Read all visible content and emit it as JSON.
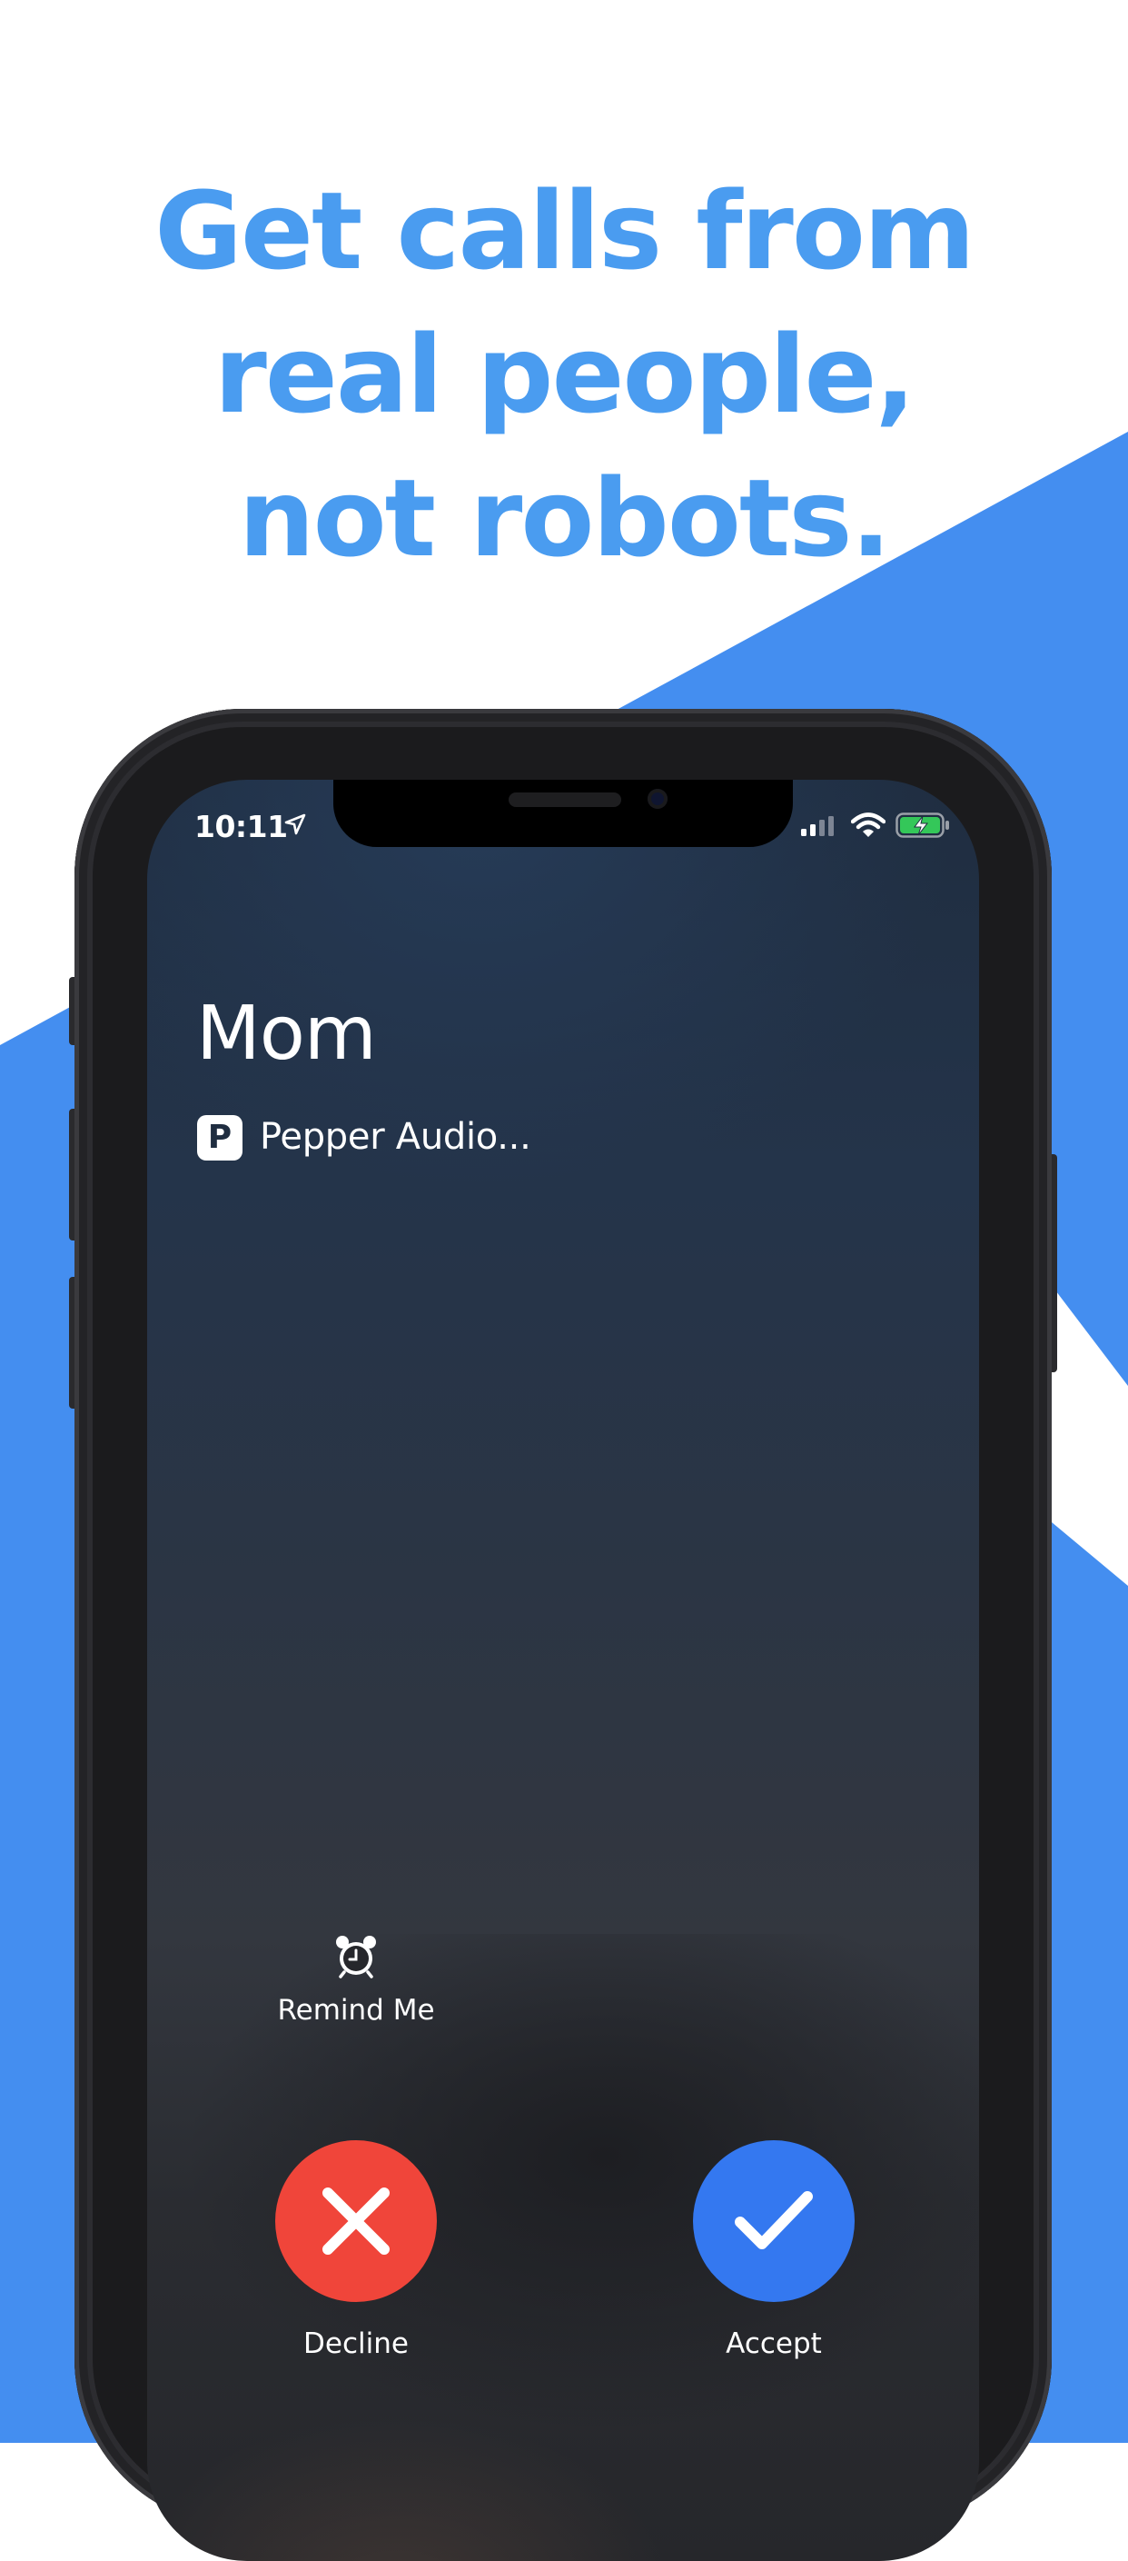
{
  "headline": {
    "line1": "Get calls from",
    "line2": "real people,",
    "line3": "not robots."
  },
  "colors": {
    "headline": "#4a9cf0",
    "background_accent": "#448ef0",
    "decline": "#f0453a",
    "accept": "#3478f0",
    "battery_charging": "#34c759"
  },
  "status_bar": {
    "time": "10:11",
    "icons": [
      "location-arrow-icon",
      "cellular-signal-icon",
      "wifi-icon",
      "battery-charging-icon"
    ]
  },
  "call": {
    "caller_name": "Mom",
    "app_badge_letter": "P",
    "app_label": "Pepper Audio..."
  },
  "actions": {
    "remind_me": "Remind Me",
    "decline": "Decline",
    "accept": "Accept"
  }
}
